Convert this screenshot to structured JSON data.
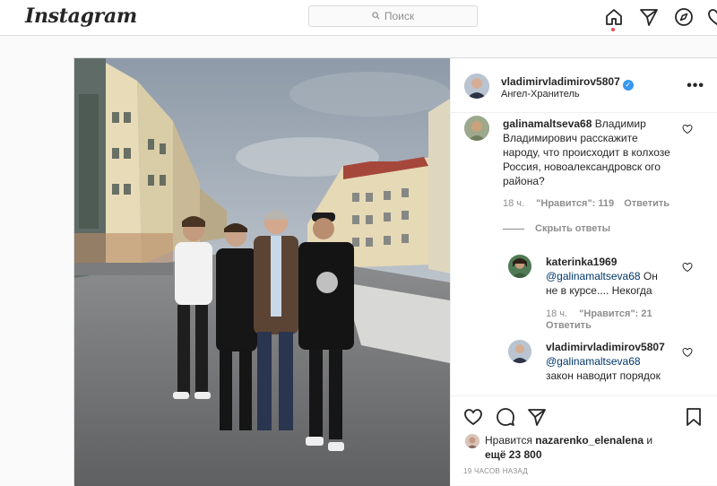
{
  "topbar": {
    "logo": "Instagram",
    "search_placeholder": "Поиск"
  },
  "post": {
    "author": {
      "username": "vladimirvladimirov5807",
      "subtitle": "Ангел-Хранитель",
      "verified": true
    },
    "comments": [
      {
        "username": "galinamaltseva68",
        "text": " Владимир Владимирович расскажите народу, что происходит в колхозе Россия, новоалександровск ого района?",
        "age": "18 ч.",
        "likes": "\"Нравится\": 119",
        "reply": "Ответить",
        "hide_replies": "Скрыть ответы",
        "replies": [
          {
            "username": "katerinka1969",
            "mention": "@galinamaltseva68",
            "text": " Он не в курсе.... Некогда",
            "age": "18 ч.",
            "likes": "\"Нравится\": 21",
            "reply": "Ответить"
          },
          {
            "username": "vladimirvladimirov5807",
            "mention": "@galinamaltseva68",
            "text": "закон наводит порядок"
          }
        ]
      }
    ],
    "likes": {
      "prefix": "Нравится ",
      "user": "nazarenko_elenalena",
      "suffix": " и",
      "others": "ещё 23 800"
    },
    "time_ago": "19 часов назад"
  },
  "colors": {
    "accent": "#3897f0",
    "mention": "#00376b",
    "notification_dot": "#ed4956"
  }
}
